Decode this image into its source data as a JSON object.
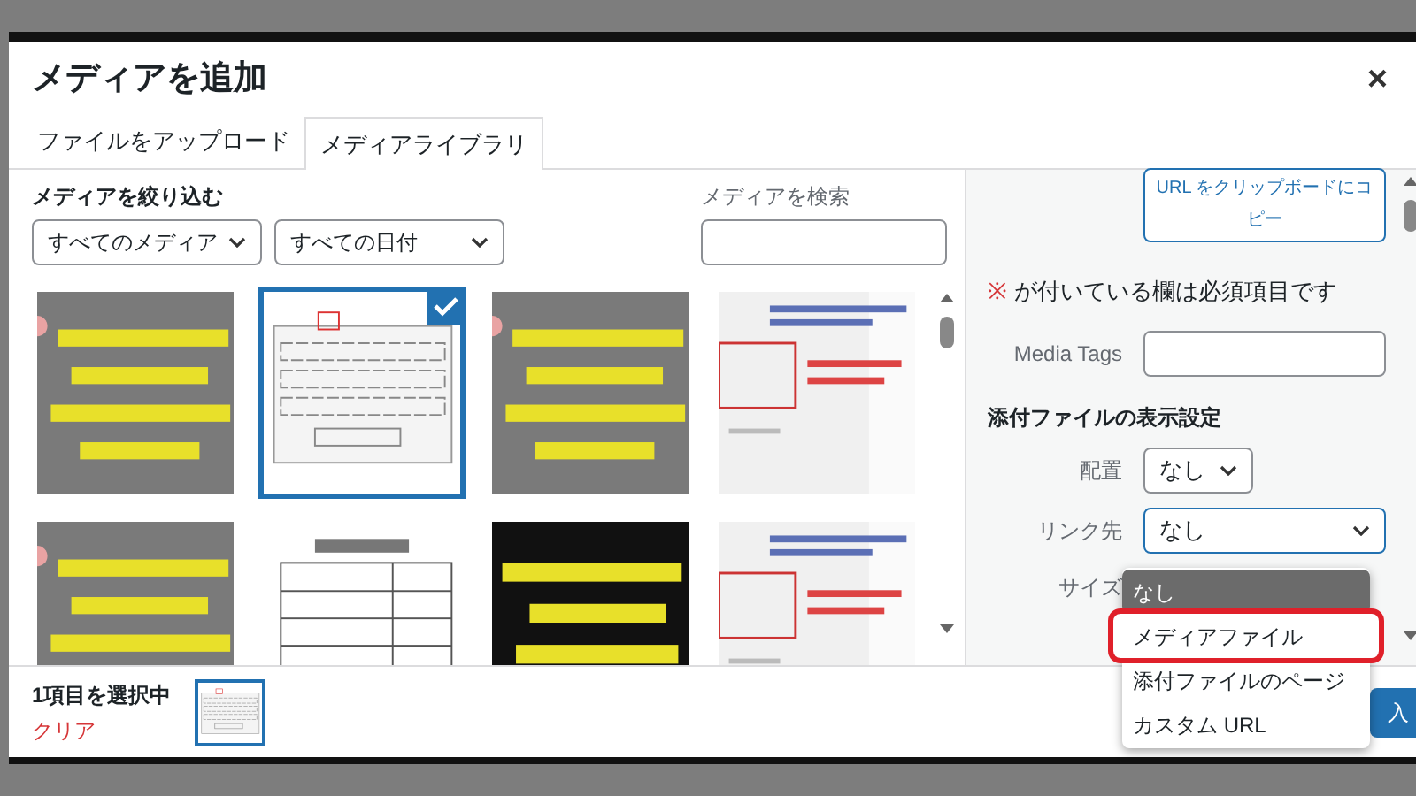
{
  "modal": {
    "title": "メディアを追加",
    "close": "×"
  },
  "tabs": [
    {
      "label": "ファイルをアップロード",
      "selected": false
    },
    {
      "label": "メディアライブラリ",
      "selected": true
    }
  ],
  "filter": {
    "label": "メディアを絞り込む",
    "type_select": "すべてのメディア",
    "date_select": "すべての日付"
  },
  "search": {
    "label": "メディアを検索"
  },
  "media": [
    {
      "kind": "picture",
      "selected": false
    },
    {
      "kind": "picture",
      "selected": true
    },
    {
      "kind": "picture",
      "selected": false
    },
    {
      "kind": "picture",
      "selected": false
    },
    {
      "kind": "picture",
      "selected": false
    },
    {
      "kind": "picture",
      "selected": false
    },
    {
      "kind": "picture",
      "selected": false
    },
    {
      "kind": "picture",
      "selected": false
    }
  ],
  "sidebar": {
    "copy_button": "URL をクリップボードにコピー",
    "required_mark": "※",
    "required_note": "が付いている欄は必須項目です",
    "media_tags_label": "Media Tags",
    "display_heading": "添付ファイルの表示設定",
    "align_label": "配置",
    "align_value": "なし",
    "link_label": "リンク先",
    "link_value": "なし",
    "size_label": "サイズ"
  },
  "link_options": [
    {
      "label": "なし",
      "selected": true,
      "highlighted": false
    },
    {
      "label": "メディアファイル",
      "selected": false,
      "highlighted": true
    },
    {
      "label": "添付ファイルのページ",
      "selected": false,
      "highlighted": false
    },
    {
      "label": "カスタム URL",
      "selected": false,
      "highlighted": false
    }
  ],
  "toolbar": {
    "selection_count": "1項目を選択中",
    "clear_link": "クリア",
    "insert_button": "入"
  }
}
